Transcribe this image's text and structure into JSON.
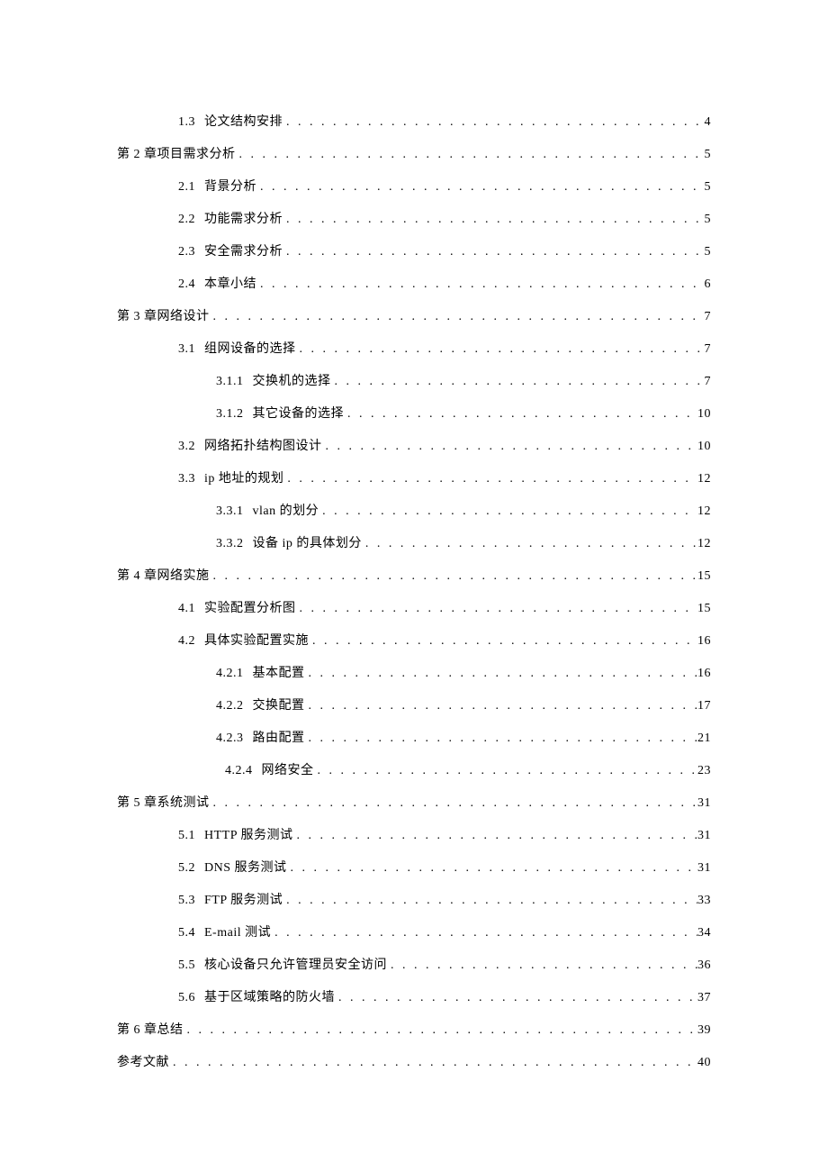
{
  "toc": [
    {
      "level": 2,
      "num": "1.3",
      "title": "论文结构安排",
      "page": "4"
    },
    {
      "level": 1,
      "num": "第 2 章",
      "title": "项目需求分析",
      "page": "5"
    },
    {
      "level": 2,
      "num": "2.1",
      "title": "背景分析",
      "page": "5"
    },
    {
      "level": 2,
      "num": "2.2",
      "title": "功能需求分析",
      "page": "5"
    },
    {
      "level": 2,
      "num": "2.3",
      "title": "安全需求分析",
      "page": "5"
    },
    {
      "level": 2,
      "num": "2.4",
      "title": "本章小结",
      "page": "6"
    },
    {
      "level": 1,
      "num": "第 3 章",
      "title": "网络设计",
      "page": "7"
    },
    {
      "level": 2,
      "num": "3.1",
      "title": "组网设备的选择",
      "page": "7"
    },
    {
      "level": 3,
      "num": "3.1.1",
      "title": "交换机的选择",
      "page": "7"
    },
    {
      "level": 3,
      "num": "3.1.2",
      "title": "其它设备的选择",
      "page": "10"
    },
    {
      "level": 2,
      "num": "3.2",
      "title": "网络拓扑结构图设计",
      "page": "10"
    },
    {
      "level": 2,
      "num": "3.3",
      "title": "ip 地址的规划",
      "page": "12"
    },
    {
      "level": 3,
      "num": "3.3.1",
      "title": "vlan 的划分",
      "page": "12"
    },
    {
      "level": 3,
      "num": "3.3.2",
      "title": "设备 ip 的具体划分",
      "page": "12"
    },
    {
      "level": 1,
      "num": "第 4 章",
      "title": "网络实施",
      "page": "15"
    },
    {
      "level": 2,
      "num": "4.1",
      "title": "实验配置分析图",
      "page": "15"
    },
    {
      "level": 2,
      "num": "4.2",
      "title": "具体实验配置实施",
      "page": "16"
    },
    {
      "level": 3,
      "num": "4.2.1",
      "title": "基本配置",
      "page": "16"
    },
    {
      "level": 3,
      "num": "4.2.2",
      "title": "交换配置",
      "page": "17"
    },
    {
      "level": 3,
      "num": "4.2.3",
      "title": "路由配置",
      "page": "21"
    },
    {
      "level": "3b",
      "num": "4.2.4",
      "title": "网络安全",
      "page": "23"
    },
    {
      "level": 1,
      "num": "第 5 章",
      "title": "系统测试",
      "page": "31"
    },
    {
      "level": 2,
      "num": "5.1",
      "title": "HTTP 服务测试",
      "page": "31"
    },
    {
      "level": 2,
      "num": "5.2",
      "title": "DNS 服务测试",
      "page": "31"
    },
    {
      "level": 2,
      "num": "5.3",
      "title": "FTP 服务测试",
      "page": "33"
    },
    {
      "level": 2,
      "num": "5.4",
      "title": "E-mail 测试",
      "page": "34"
    },
    {
      "level": 2,
      "num": "5.5",
      "title": "核心设备只允许管理员安全访问",
      "page": "36"
    },
    {
      "level": 2,
      "num": "5.6",
      "title": "基于区域策略的防火墙",
      "page": "37"
    },
    {
      "level": 1,
      "num": "第 6 章",
      "title": "总结",
      "page": "39"
    },
    {
      "level": 1,
      "num": "",
      "title": "参考文献",
      "page": "40"
    }
  ]
}
